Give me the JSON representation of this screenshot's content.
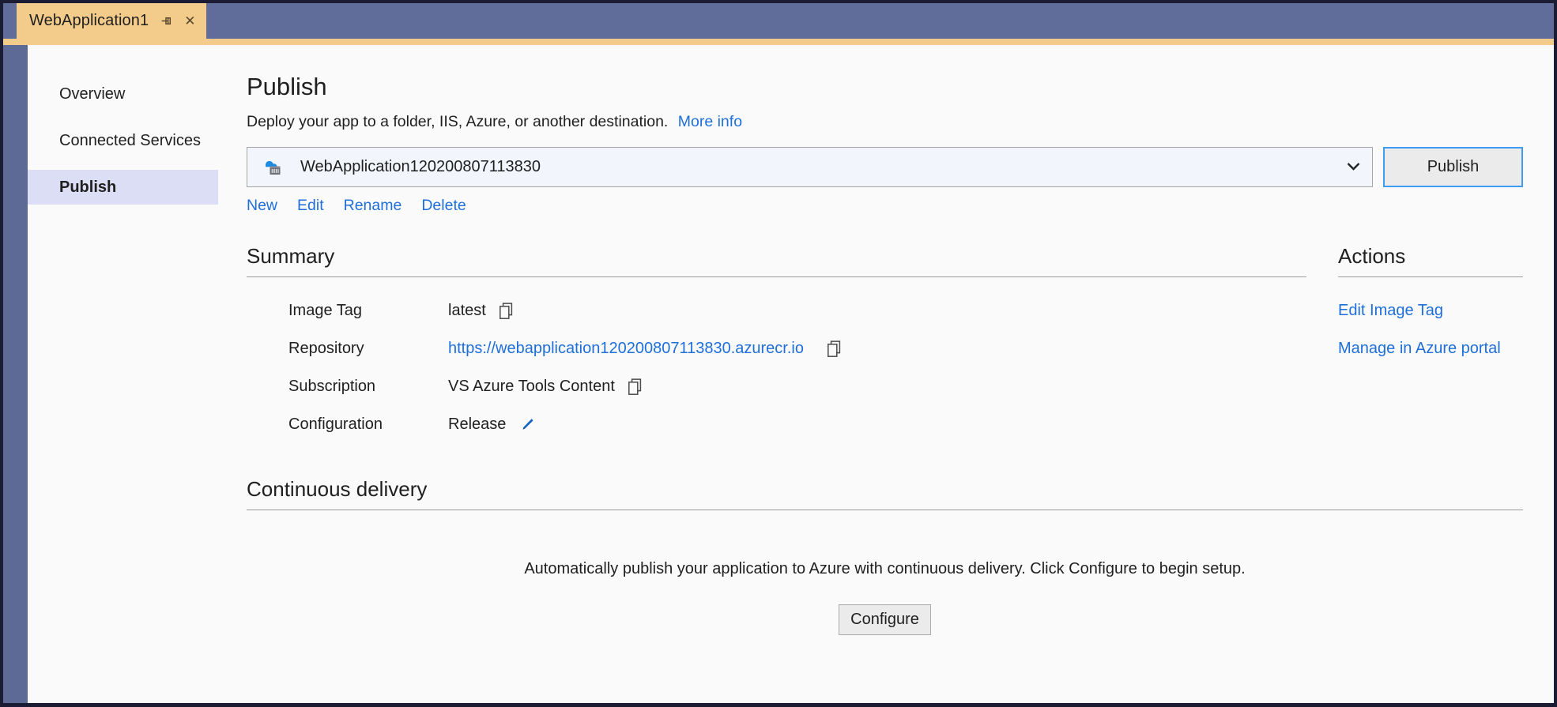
{
  "window": {
    "tab": {
      "title": "WebApplication1",
      "pin_icon": "pin-icon",
      "close_icon": "close-icon",
      "close_glyph": "✕"
    },
    "colors": {
      "tab_background": "#f3cc8c",
      "tabstrip_background": "#606c99",
      "frame_border": "#1b1b33",
      "accent_link": "#1e6fd9",
      "selected_item": "#dcdef5",
      "focus_border": "#3d9bf0"
    }
  },
  "sidebar": {
    "items": [
      {
        "label": "Overview",
        "selected": false
      },
      {
        "label": "Connected Services",
        "selected": false
      },
      {
        "label": "Publish",
        "selected": true
      }
    ]
  },
  "main": {
    "title": "Publish",
    "subtitle": "Deploy your app to a folder, IIS, Azure, or another destination.",
    "more_info_label": "More info",
    "profile": {
      "selected": "WebApplication120200807113830",
      "icon": "azure-container-registry-icon",
      "chevron_icon": "chevron-down-icon",
      "publish_button": "Publish"
    },
    "profile_actions": [
      {
        "label": "New"
      },
      {
        "label": "Edit"
      },
      {
        "label": "Rename"
      },
      {
        "label": "Delete"
      }
    ],
    "summary": {
      "heading": "Summary",
      "rows": [
        {
          "label": "Image Tag",
          "value": "latest",
          "is_link": false,
          "action_icon": "copy-icon"
        },
        {
          "label": "Repository",
          "value": "https://webapplication120200807113830.azurecr.io",
          "is_link": true,
          "action_icon": "copy-icon"
        },
        {
          "label": "Subscription",
          "value": "VS Azure Tools Content",
          "is_link": false,
          "action_icon": "copy-icon"
        },
        {
          "label": "Configuration",
          "value": "Release",
          "is_link": false,
          "action_icon": "pencil-icon"
        }
      ]
    },
    "actions": {
      "heading": "Actions",
      "items": [
        {
          "label": "Edit Image Tag"
        },
        {
          "label": "Manage in Azure portal"
        }
      ]
    },
    "continuous_delivery": {
      "heading": "Continuous delivery",
      "description": "Automatically publish your application to Azure with continuous delivery. Click Configure to begin setup.",
      "configure_button": "Configure"
    }
  }
}
